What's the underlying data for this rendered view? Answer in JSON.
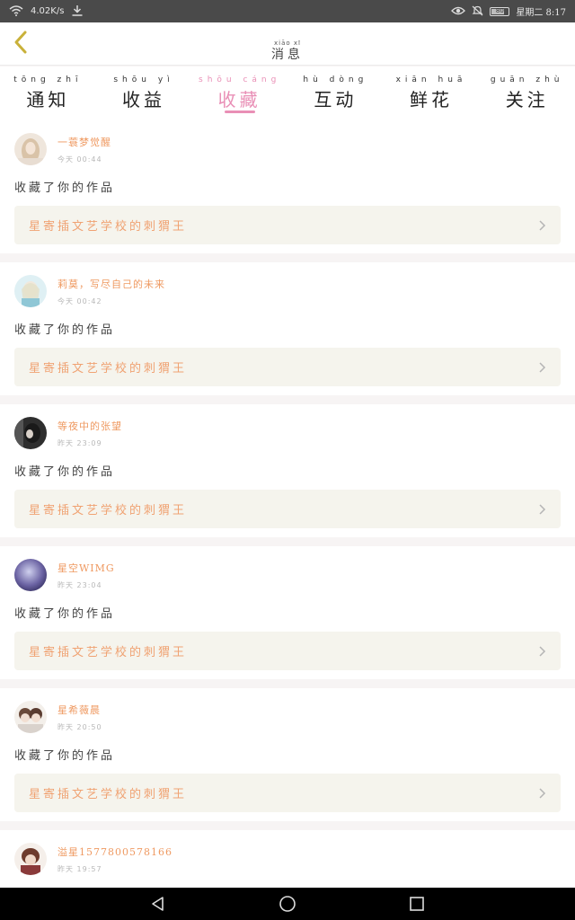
{
  "status_bar": {
    "net_speed": "4.02K/s",
    "battery_level": 0.8,
    "battery_text": "80",
    "date_time": "星期二 8:17",
    "icons": [
      "wifi-icon",
      "download-icon",
      "eye-icon",
      "mute-icon",
      "battery-icon"
    ]
  },
  "header": {
    "title": "消息",
    "title_pinyin": "xiāo xī",
    "back_icon": "chevron-left-icon",
    "accent_color": "#c9b13a"
  },
  "tabs": [
    {
      "label": "通知",
      "pinyin": "tōng zhī",
      "active": false
    },
    {
      "label": "收益",
      "pinyin": "shōu yì",
      "active": false
    },
    {
      "label": "收藏",
      "pinyin": "shōu cáng",
      "active": true
    },
    {
      "label": "互动",
      "pinyin": "hù dòng",
      "active": false
    },
    {
      "label": "鲜花",
      "pinyin": "xiān huā",
      "active": false
    },
    {
      "label": "关注",
      "pinyin": "guān zhù",
      "active": false
    }
  ],
  "colors": {
    "tab_active": "#e98fb6",
    "user_name": "#ef9a62",
    "work_title": "#f0a272",
    "link_bg": "#f5f4ed"
  },
  "notifications": [
    {
      "user": "一蓑梦觉醒",
      "time": "00:44",
      "time_prefix": "今天",
      "action": "收藏了你的作品",
      "work": "星寄插文艺学校的刺猬王"
    },
    {
      "user": "莉莫，写尽自己的未来",
      "time": "00:42",
      "time_prefix": "今天",
      "action": "收藏了你的作品",
      "work": "星寄插文艺学校的刺猬王"
    },
    {
      "user": "等夜中的张望",
      "time": "23:09",
      "time_prefix": "昨天",
      "action": "收藏了你的作品",
      "work": "星寄插文艺学校的刺猬王"
    },
    {
      "user": "星空WIMG",
      "time": "23:04",
      "time_prefix": "昨天",
      "action": "收藏了你的作品",
      "work": "星寄插文艺学校的刺猬王"
    },
    {
      "user": "星希薇晨",
      "time": "20:50",
      "time_prefix": "昨天",
      "action": "收藏了你的作品",
      "work": "星寄插文艺学校的刺猬王"
    },
    {
      "user": "溢星1577800578166",
      "time": "19:57",
      "time_prefix": "昨天",
      "action": "",
      "work": ""
    }
  ],
  "nav_bar": {
    "buttons": [
      "back-triangle-icon",
      "home-circle-icon",
      "recents-square-icon"
    ]
  }
}
